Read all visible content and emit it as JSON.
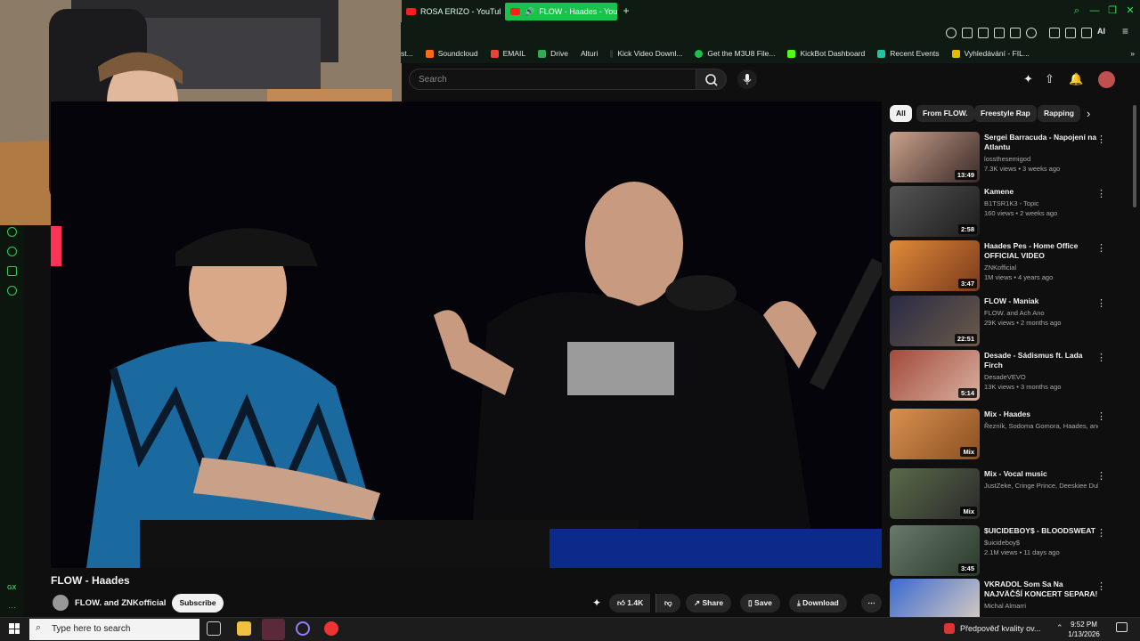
{
  "browser": {
    "tabs": [
      {
        "label": "ROSA ERIZO - YouTube",
        "active": false
      },
      {
        "label": "FLOW - Haades - YouTube",
        "active": true
      }
    ],
    "bookmarks": [
      "st...",
      "Soundcloud",
      "EMAIL",
      "Drive",
      "Alturi",
      "Kick Video Downl...",
      "Get the M3U8 File...",
      "KickBot Dashboard",
      "Recent Events",
      "Vyhledávání - FIL..."
    ],
    "toolbar_ai_label": "AI"
  },
  "gx_sidebar": {
    "badge": "GX"
  },
  "youtube": {
    "search_placeholder": "Search",
    "chips": [
      "All",
      "From FLOW.",
      "Freestyle Rap",
      "Rapping"
    ],
    "video": {
      "title": "FLOW - Haades",
      "channel": "FLOW. and ZNKofficial",
      "subscribe_label": "Subscribe",
      "likes": "1.4K",
      "share_label": "Share",
      "save_label": "Save",
      "download_label": "Download"
    },
    "recommendations": [
      {
        "title": "Sergei Barracuda - Napojení na Atlantu",
        "channel": "lossthesemigod",
        "meta": "7.3K views • 3 weeks ago",
        "duration": "13:49",
        "colors": [
          "#c9a08a",
          "#3a2a2a"
        ]
      },
      {
        "title": "Kamene",
        "channel": "B1TSR1K3 - Topic",
        "meta": "160 views • 2 weeks ago",
        "duration": "2:58",
        "colors": [
          "#555",
          "#1c1c1c"
        ]
      },
      {
        "title": "Haades Pes - Home Office OFFICIAL VIDEO",
        "channel": "ZNKofficial",
        "meta": "1M views • 4 years ago",
        "duration": "3:47",
        "colors": [
          "#e08a3a",
          "#7a3a1a"
        ]
      },
      {
        "title": "FLOW - Maniak",
        "channel": "FLOW. and Ach Ano",
        "meta": "29K views • 2 months ago",
        "duration": "22:51",
        "colors": [
          "#2a2a44",
          "#6a5a4a"
        ]
      },
      {
        "title": "Desade - Sádismus ft. Lada Firch",
        "channel": "DesadeVEVO",
        "meta": "13K views • 3 months ago",
        "duration": "5:14",
        "colors": [
          "#a24a3a",
          "#d9b0a0"
        ]
      },
      {
        "title": "Mix - Haades",
        "channel": "Řezník, Sodoma Gomora, Haades, and m...",
        "meta": "",
        "duration": "Mix",
        "colors": [
          "#d99050",
          "#8a5020"
        ]
      },
      {
        "title": "Mix - Vocal music",
        "channel": "JustZeke, Cringe Prince, Deeskiee Dub, a...",
        "meta": "",
        "duration": "Mix",
        "colors": [
          "#5a6a4a",
          "#2a2a2a"
        ]
      },
      {
        "title": "$UICIDEBOY$ - BLOODSWEAT",
        "channel": "$uicideboy$",
        "meta": "2.1M views • 11 days ago",
        "duration": "3:45",
        "colors": [
          "#6a7a6a",
          "#2a3a2a"
        ]
      },
      {
        "title": "VKRADOL Som Sa Na NAJVÄČŠÍ KONCERT SEPARA!",
        "channel": "Michal Almarri",
        "meta": "",
        "duration": "",
        "colors": [
          "#3a6ad0",
          "#e0d0c0"
        ]
      }
    ]
  },
  "taskbar": {
    "search_placeholder": "Type here to search",
    "weather": "Předpověď kvality ov...",
    "time": "9:52 PM",
    "date": "1/13/2026"
  },
  "colors": {
    "accent_green": "#19c24a",
    "youtube_red": "#ff0000",
    "bg": "#0f0f0f"
  }
}
